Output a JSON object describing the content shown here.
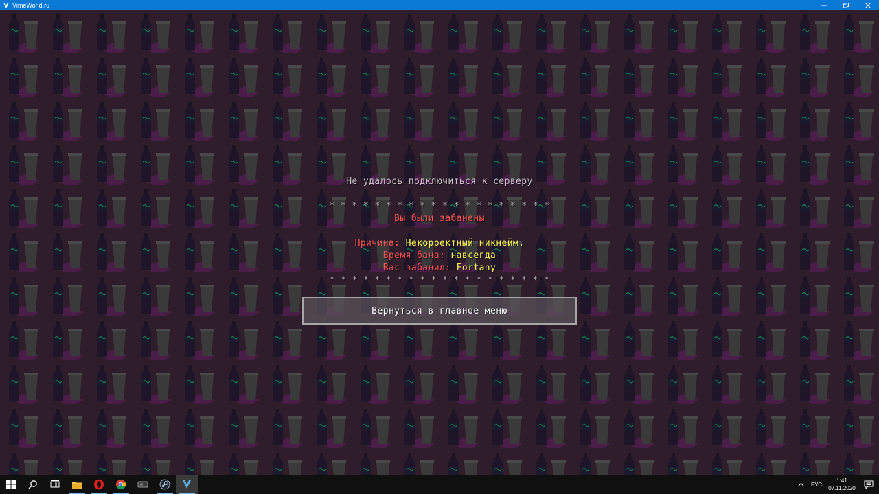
{
  "window": {
    "title": "VimeWorld.ru",
    "buttons": [
      "minimize",
      "restore",
      "close"
    ]
  },
  "screen": {
    "heading": "Не удалось подключиться к серверу",
    "separator": "* * * * * * * * * * * * * * * * * * * *",
    "ban_title": "Вы были забанены",
    "reason_label": "Причина: ",
    "reason_value": "Некорректный никнейм.",
    "duration_label": "Время бана: ",
    "duration_value": "навсегда",
    "banned_by_label": "Вас забанил: ",
    "banned_by_value": "Fortany",
    "back_button": "Вернуться в главное меню"
  },
  "colors": {
    "titlebar": "#0a7ad6",
    "background": "#2f1d2c",
    "red": "#ff5555",
    "yellow": "#ffff55",
    "gray": "#c9c4c9"
  },
  "taskbar": {
    "apps": [
      "windows-start",
      "search",
      "task-view",
      "file-explorer",
      "opera",
      "chrome",
      "gpu-app",
      "steam",
      "vimeworld"
    ],
    "language": "РУС",
    "time": "1:41",
    "date": "07.11.2020"
  }
}
